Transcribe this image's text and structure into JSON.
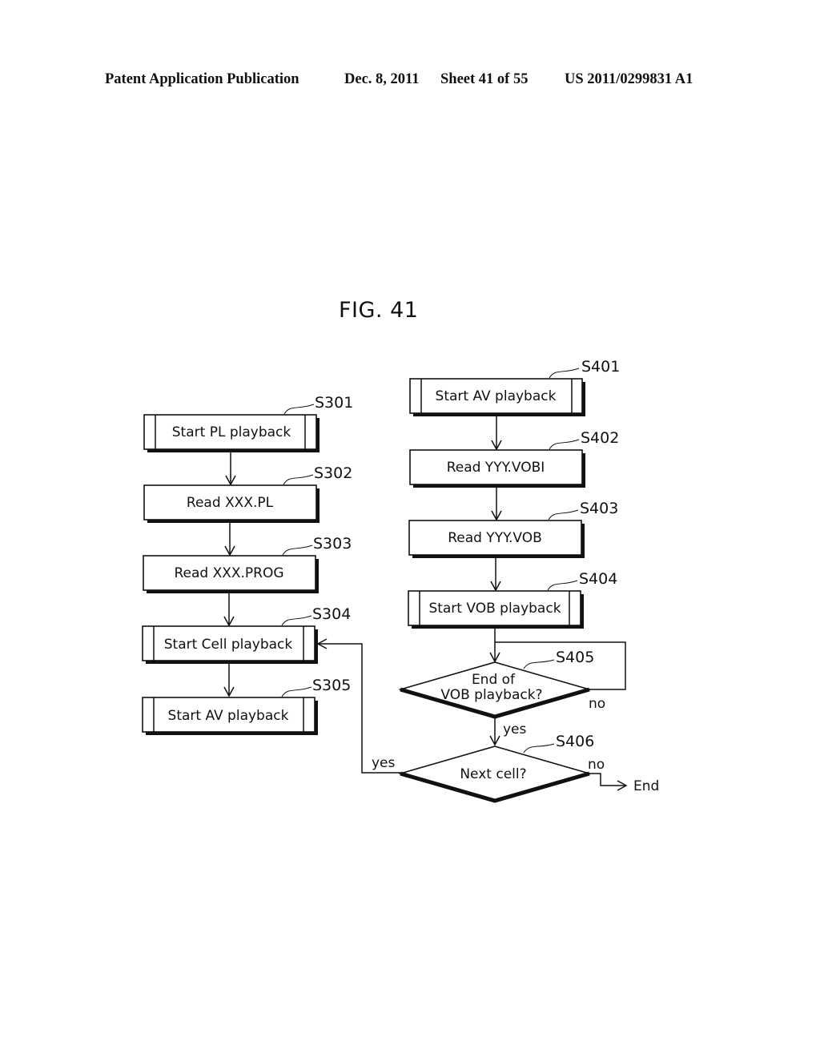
{
  "header": {
    "publication": "Patent Application Publication",
    "date": "Dec. 8, 2011",
    "sheet": "Sheet 41 of 55",
    "number": "US 2011/0299831 A1"
  },
  "figure": {
    "title": "FIG. 41"
  },
  "left_flow": {
    "steps": [
      {
        "id": "S301",
        "label": "Start PL playback",
        "type": "subroutine"
      },
      {
        "id": "S302",
        "label": "Read XXX.PL",
        "type": "process"
      },
      {
        "id": "S303",
        "label": "Read XXX.PROG",
        "type": "process"
      },
      {
        "id": "S304",
        "label": "Start Cell playback",
        "type": "subroutine"
      },
      {
        "id": "S305",
        "label": "Start AV playback",
        "type": "subroutine"
      }
    ]
  },
  "right_flow": {
    "steps": [
      {
        "id": "S401",
        "label": "Start AV playback",
        "type": "subroutine"
      },
      {
        "id": "S402",
        "label": "Read YYY.VOBI",
        "type": "process"
      },
      {
        "id": "S403",
        "label": "Read YYY.VOB",
        "type": "process"
      },
      {
        "id": "S404",
        "label": "Start VOB playback",
        "type": "subroutine"
      }
    ],
    "decisions": [
      {
        "id": "S405",
        "label_line1": "End of",
        "label_line2": "VOB playback?",
        "yes": "yes",
        "no": "no"
      },
      {
        "id": "S406",
        "label": "Next cell?",
        "yes": "yes",
        "no": "no"
      }
    ],
    "end_label": "End"
  }
}
